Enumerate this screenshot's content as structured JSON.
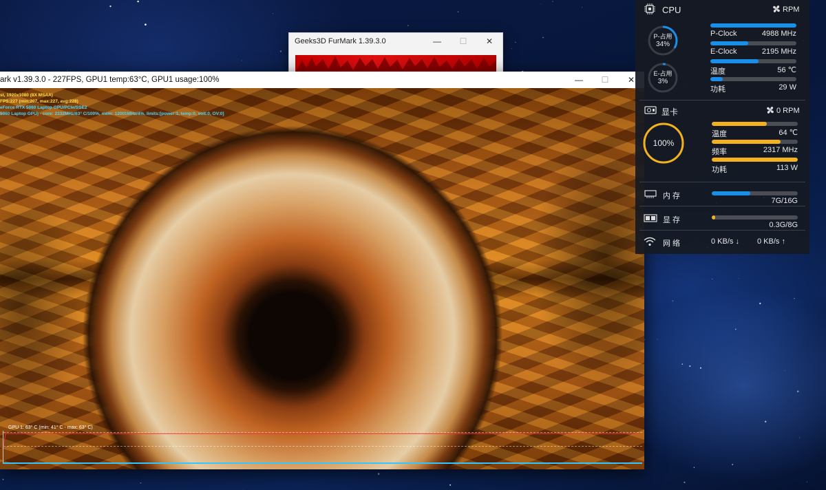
{
  "launcher": {
    "title": "Geeks3D FurMark 1.39.3.0"
  },
  "furmark": {
    "title": "ark v1.39.3.0 - 227FPS, GPU1 temp:63°C, GPU1 usage:100%",
    "osd": [
      {
        "text": "st, 1920x1080 (8X MSAA)",
        "color": "yellow"
      },
      {
        "text": "FPS:227 (min:207, max:227, avg:228)",
        "color": "yellow"
      },
      {
        "text": "eForce RTX 5060 Laptop GPU/PCIe/SSE2",
        "color": "cyan"
      },
      {
        "text": "5060 Laptop GPU) - core: 2332MHz/63° C/100%, mem: 12001MHz/4%, limits:[power:1, temp:0, volt:0, OV:0]",
        "color": "cyan"
      }
    ],
    "graph_label": "GPU 1: 63° C (min: 41° C - max: 63° C)"
  },
  "monitor": {
    "cpu": {
      "title": "CPU",
      "fan": "RPM",
      "p_ring": {
        "label": "P-占用",
        "value": "34%",
        "percent": 34
      },
      "e_ring": {
        "label": "E-占用",
        "value": "3%",
        "percent": 3
      },
      "rows": [
        {
          "label": "P-Clock",
          "value": "4988 MHz",
          "fill": 1.0
        },
        {
          "label": "E-Clock",
          "value": "2195 MHz",
          "fill": 0.44
        },
        {
          "label": "温度",
          "value": "56 ℃",
          "fill": 0.56
        },
        {
          "label": "功耗",
          "value": "29 W",
          "fill": 0.14
        }
      ],
      "color": "#1a8fe8"
    },
    "gpu": {
      "title": "显卡",
      "fan": "0 RPM",
      "ring_value": "100%",
      "percent": 100,
      "rows": [
        {
          "label": "温度",
          "value": "64 ℃",
          "fill": 0.64
        },
        {
          "label": "频率",
          "value": "2317 MHz",
          "fill": 0.8
        },
        {
          "label": "功耗",
          "value": "113 W",
          "fill": 1.0
        }
      ],
      "color": "#f3b21d"
    },
    "memory": {
      "label": "内 存",
      "value": "7G/16G",
      "fill": 0.45,
      "color": "#1a8fe8"
    },
    "vram": {
      "label": "显 存",
      "value": "0.3G/8G",
      "fill": 0.04,
      "color": "#f3b21d"
    },
    "network": {
      "label": "网 络",
      "down": "0 KB/s ↓",
      "up": "0 KB/s ↑"
    }
  }
}
